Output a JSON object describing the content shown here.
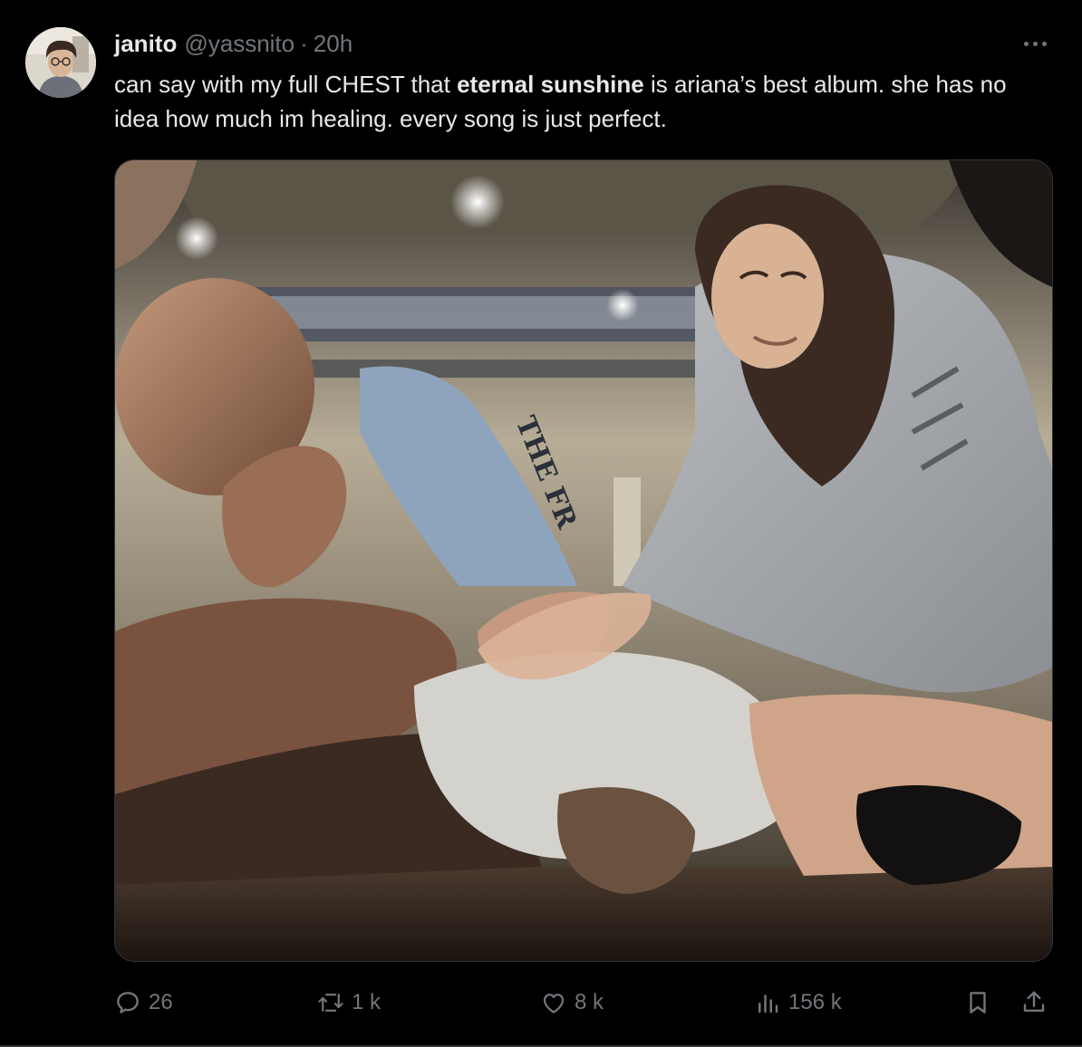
{
  "author": {
    "display_name": "janito",
    "handle": "@yassnito",
    "separator": "·",
    "time": "20h"
  },
  "tweet": {
    "text_part1": "can say with my full CHEST that ",
    "text_bold": "eternal sunshine",
    "text_part2": " is ariana’s best album. she has no idea how much im healing. every song is just perfect."
  },
  "media": {
    "shirt_text": "THE FR"
  },
  "actions": {
    "replies": "26",
    "retweets": "1 k",
    "likes": "8 k",
    "views": "156 k"
  },
  "icons": {
    "more": "more-options-icon",
    "reply": "reply-icon",
    "retweet": "retweet-icon",
    "like": "heart-icon",
    "views": "views-chart-icon",
    "bookmark": "bookmark-icon",
    "share": "share-icon"
  },
  "colors": {
    "background": "#000000",
    "text_primary": "#e7e9ea",
    "text_secondary": "#71767b",
    "border": "#2f3336"
  }
}
